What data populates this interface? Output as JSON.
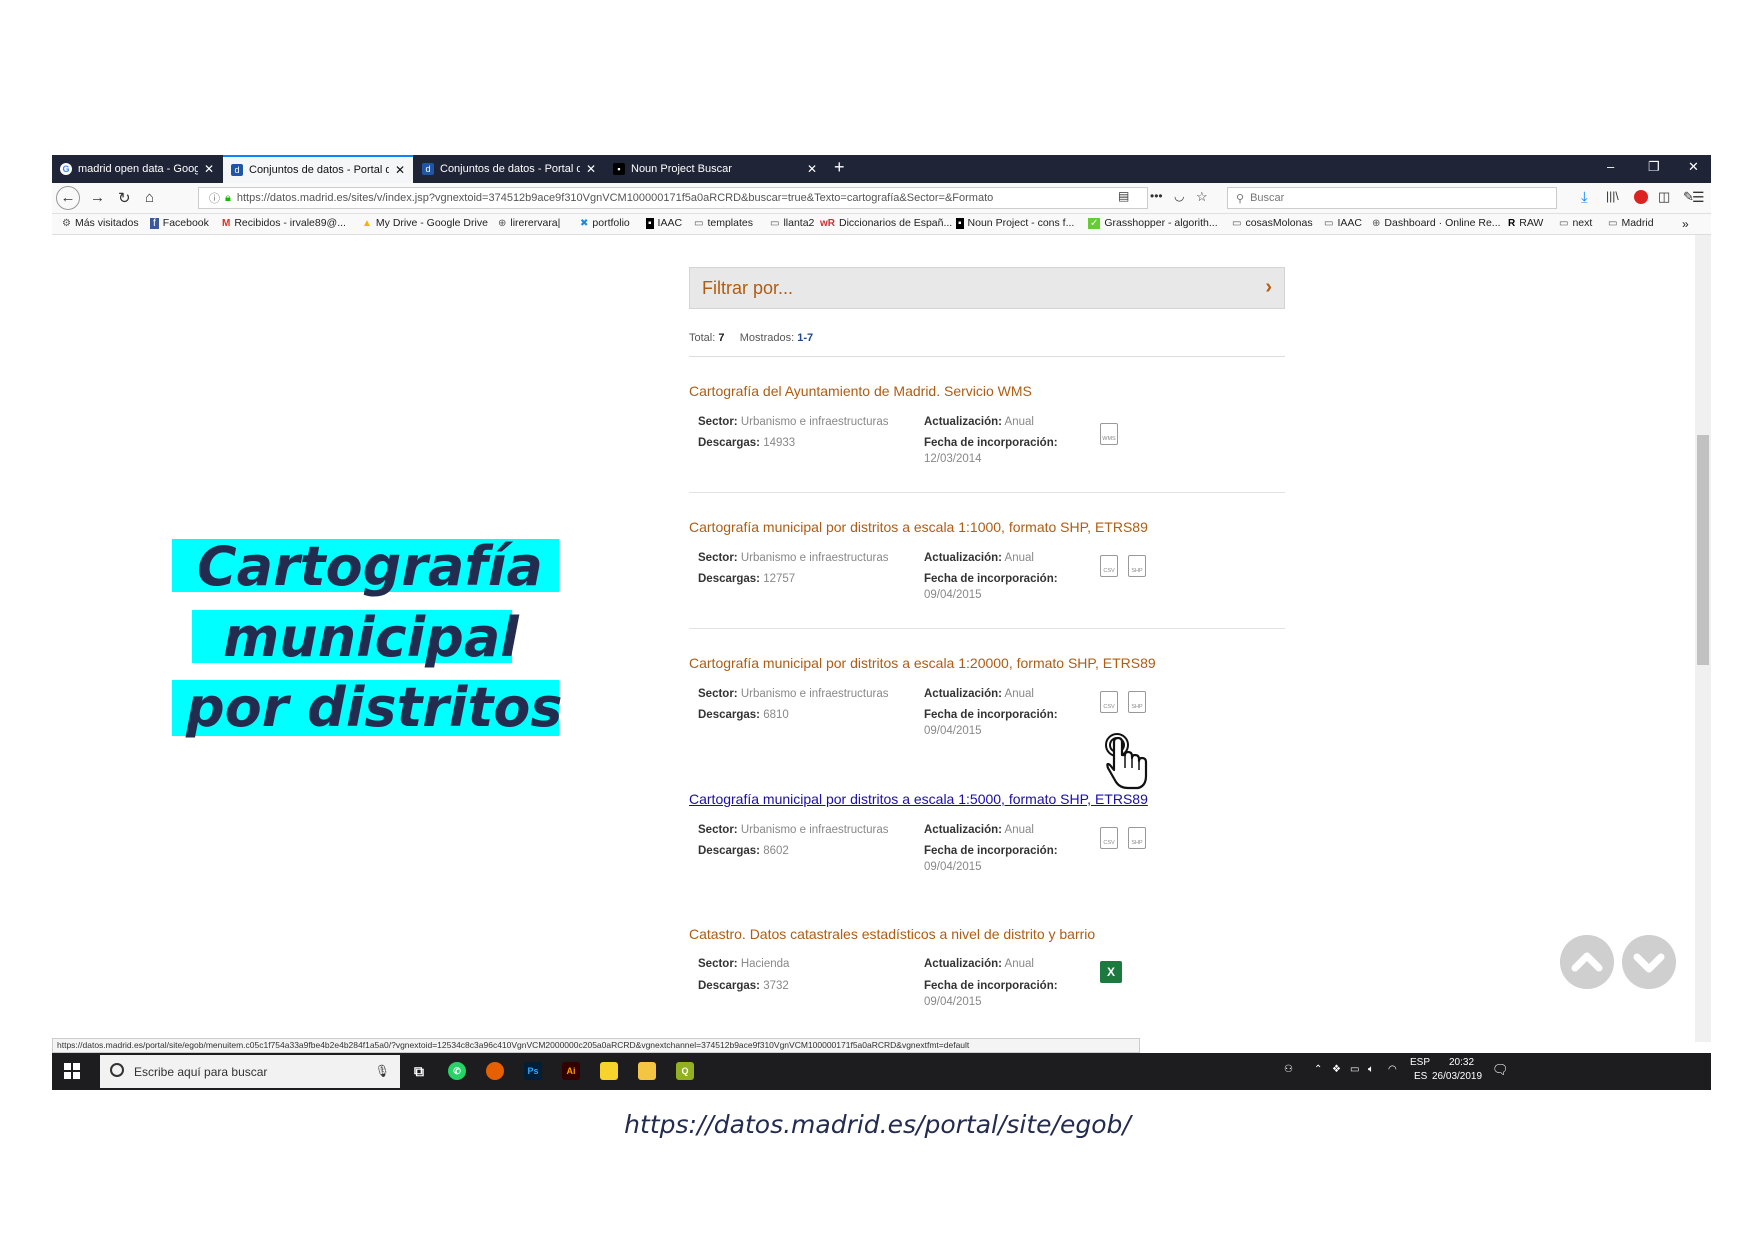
{
  "browser": {
    "tabs": [
      {
        "title": "madrid open data - Google Sea",
        "favicon": "google-icon"
      },
      {
        "title": "Conjuntos de datos - Portal de",
        "favicon": "madrid-portal-icon",
        "active": true
      },
      {
        "title": "Conjuntos de datos - Portal de",
        "favicon": "madrid-portal-icon"
      },
      {
        "title": "Noun Project Buscar",
        "favicon": "noun-project-icon"
      }
    ],
    "new_tab": "+",
    "window_controls": {
      "minimize": "–",
      "restore": "❐",
      "close": "✕"
    },
    "url": "https://datos.madrid.es/sites/v/index.jsp?vgnextoid=374512b9ace9f310VgnVCM100000171f5a0aRCRD&buscar=true&Texto=cartografía&Sector=&Formato",
    "search_placeholder": "Buscar",
    "bookmarks": [
      "Más visitados",
      "Facebook",
      "Recibidos - irvale89@...",
      "My Drive - Google Drive",
      "lirerervara|",
      "portfolio",
      "IAAC",
      "templates",
      "llanta2",
      "Diccionarios de Españ...",
      "Noun Project - cons f...",
      "Grasshopper - algorith...",
      "cosasMolonas",
      "IAAC",
      "Dashboard · Online Re...",
      "RAW",
      "next",
      "Madrid"
    ],
    "status_url": "https://datos.madrid.es/portal/site/egob/menuitem.c05c1f754a33a9fbe4b2e4b284f1a5a0/?vgnextoid=12534c8c3a96c410VgnVCM2000000c205a0aRCRD&vgnextchannel=374512b9ace9f310VgnVCM100000171f5a0aRCRD&vgnextfmt=default"
  },
  "page": {
    "filter_label": "Filtrar por...",
    "totals": {
      "total_label": "Total:",
      "total": "7",
      "shown_label": "Mostrados:",
      "shown": "1-7"
    },
    "labels": {
      "sector": "Sector:",
      "descargas": "Descargas:",
      "actualizacion": "Actualización:",
      "fecha": "Fecha de incorporación:"
    },
    "results": [
      {
        "title": "Cartografía del Ayuntamiento de Madrid. Servicio WMS",
        "sector": "Urbanismo e infraestructuras",
        "descargas": "14933",
        "actualizacion": "Anual",
        "fecha": "12/03/2014",
        "formats": [
          "WMS"
        ]
      },
      {
        "title": "Cartografía municipal por distritos a escala 1:1000, formato SHP, ETRS89",
        "sector": "Urbanismo e infraestructuras",
        "descargas": "12757",
        "actualizacion": "Anual",
        "fecha": "09/04/2015",
        "formats": [
          "CSV",
          "SHP"
        ]
      },
      {
        "title": "Cartografía municipal por distritos a escala 1:20000, formato SHP, ETRS89",
        "sector": "Urbanismo e infraestructuras",
        "descargas": "6810",
        "actualizacion": "Anual",
        "fecha": "09/04/2015",
        "formats": [
          "CSV",
          "SHP"
        ]
      },
      {
        "title": "Cartografía municipal por distritos a escala 1:5000, formato SHP, ETRS89",
        "sector": "Urbanismo e infraestructuras",
        "descargas": "8602",
        "actualizacion": "Anual",
        "fecha": "09/04/2015",
        "formats": [
          "CSV",
          "SHP"
        ],
        "hovered": true
      },
      {
        "title": "Catastro. Datos catastrales estadísticos a nivel de distrito y barrio",
        "sector": "Hacienda",
        "descargas": "3732",
        "actualizacion": "Anual",
        "fecha": "09/04/2015",
        "formats": [
          "XLS"
        ]
      }
    ]
  },
  "taskbar": {
    "search_placeholder": "Escribe aquí para buscar",
    "lang_top": "ESP",
    "lang_bottom": "ES",
    "time": "20:32",
    "date": "26/03/2019"
  },
  "overlay": {
    "title_lines": [
      "Cartografía",
      "municipal",
      "por distritos"
    ],
    "highlight_color": "#00ffff",
    "text_color": "#232b4f"
  },
  "caption": "https://datos.madrid.es/portal/site/egob/",
  "colors": {
    "accent": "#b05c12",
    "link": "#1a0dab",
    "tabbar": "#1f2437"
  }
}
